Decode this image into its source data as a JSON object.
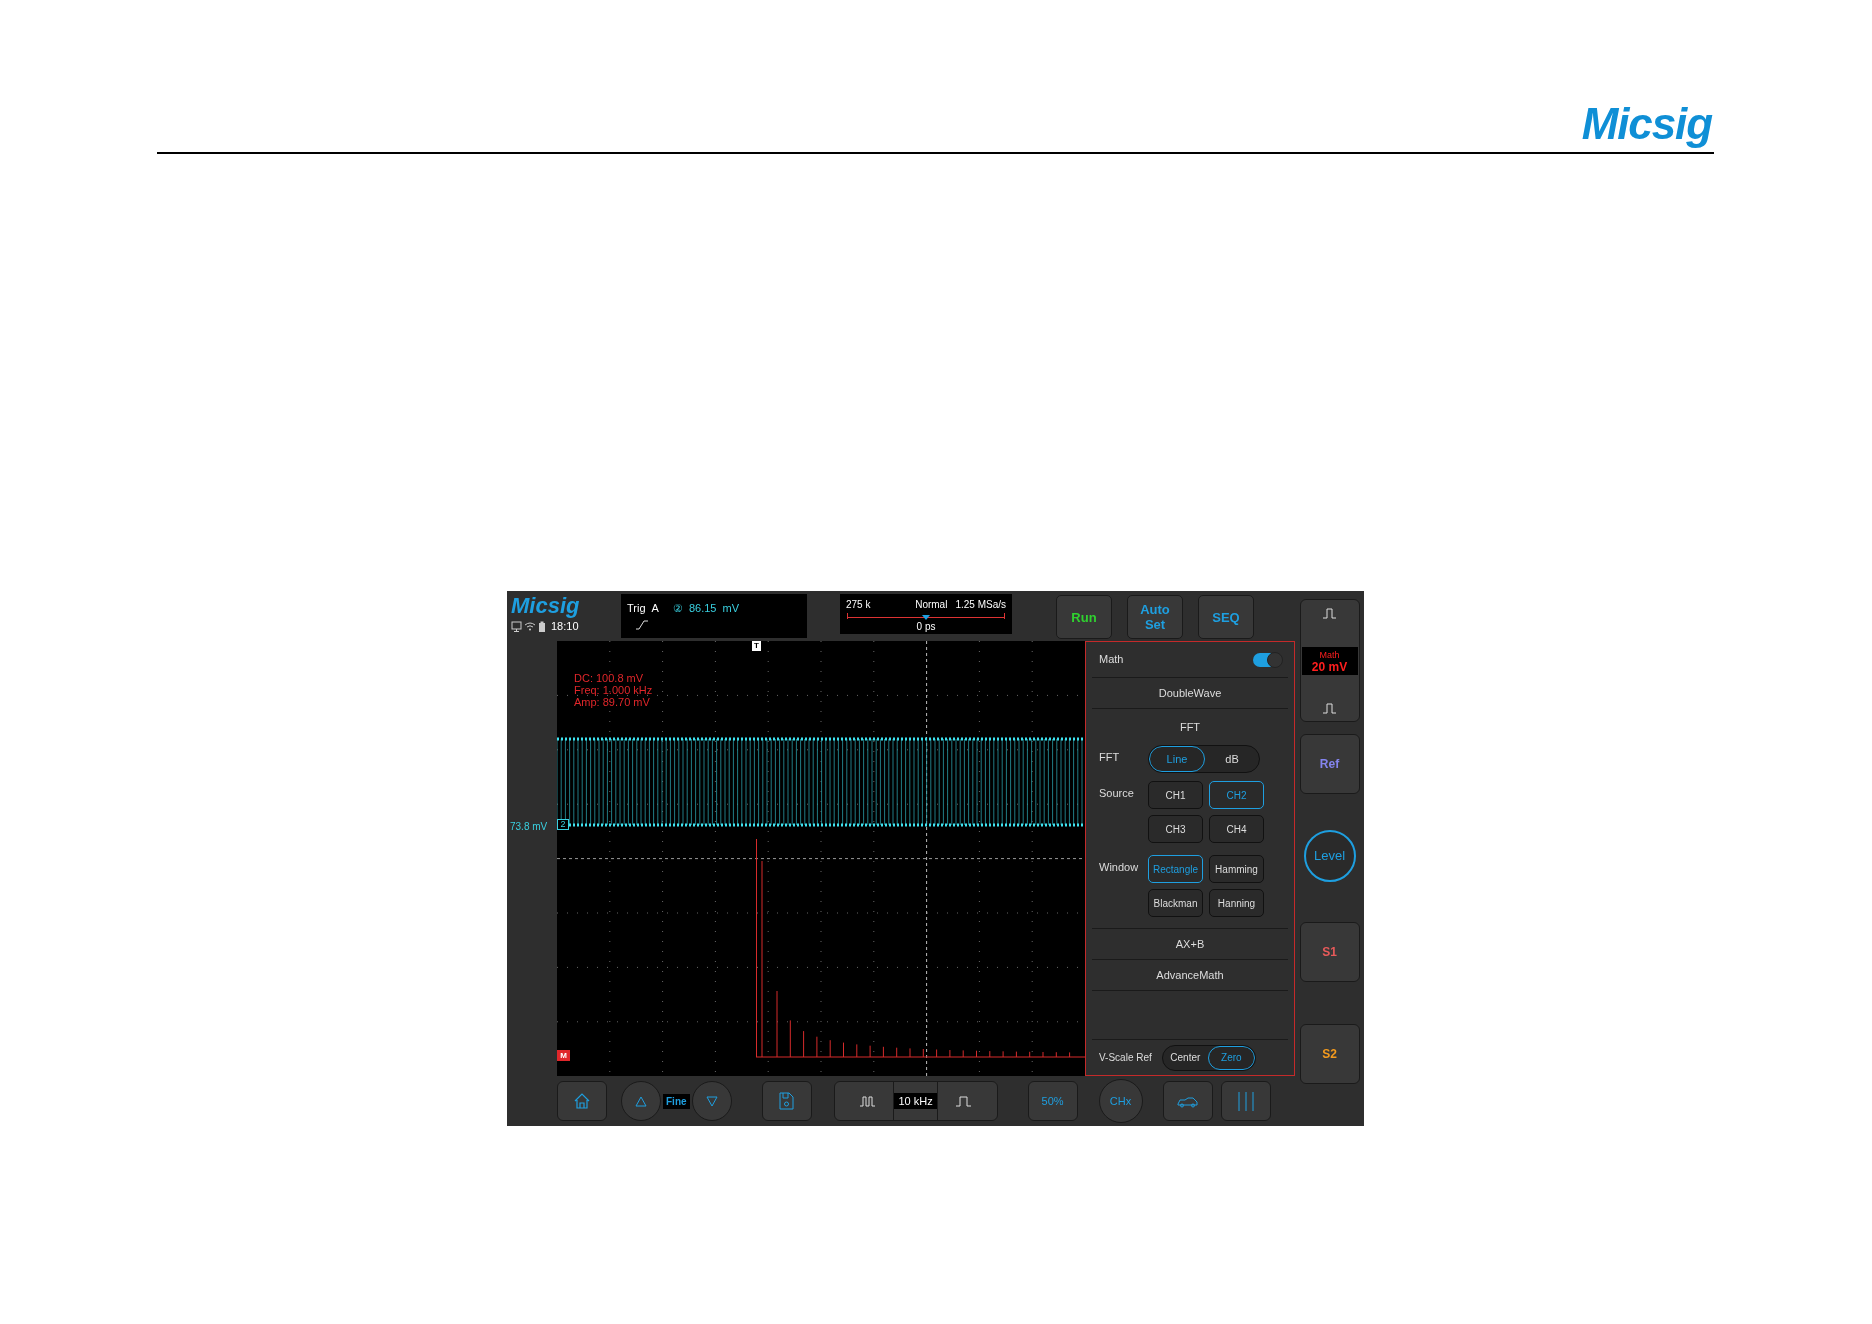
{
  "header": {
    "logo": "Micsig"
  },
  "scope": {
    "brand": "Micsig",
    "time": "18:10",
    "trigger": {
      "label": "Trig",
      "source": "A",
      "channel": "②",
      "value": "86.15  mV"
    },
    "timebase": {
      "memory": "275 k",
      "mode": "Normal",
      "sample_rate": "1.25 MSa/s",
      "offset": "0 ps",
      "level": 0.5
    },
    "top_buttons": [
      {
        "label": "Run",
        "color": "#2fd12f"
      },
      {
        "label": "Auto Set",
        "color": "#1e9fe0"
      },
      {
        "label": "SEQ",
        "color": "#1e9fe0"
      }
    ],
    "trigger_marker": "T",
    "channel_marker": "2",
    "channel_offset": "73.8 mV",
    "math_marker": "M",
    "measurements": [
      "DC: 100.8 mV",
      "Freq: 1.000 kHz",
      "Amp: 89.70 mV"
    ],
    "math_panel": {
      "title": "Math",
      "on": true,
      "items_before": [
        "DoubleWave"
      ],
      "fft_heading": "FFT",
      "fft_rows": [
        {
          "label": "FFT",
          "kind": "segmented",
          "options": [
            {
              "label": "Line",
              "selected": true
            },
            {
              "label": "dB",
              "selected": false
            }
          ]
        },
        {
          "label": "Source",
          "kind": "grid",
          "options": [
            {
              "label": "CH1",
              "selected": false
            },
            {
              "label": "CH2",
              "selected": true
            },
            {
              "label": "CH3",
              "selected": false
            },
            {
              "label": "CH4",
              "selected": false
            }
          ]
        },
        {
          "label": "Window",
          "kind": "grid",
          "options": [
            {
              "label": "Rectangle",
              "selected": true
            },
            {
              "label": "Hamming",
              "selected": false
            },
            {
              "label": "Blackman",
              "selected": false
            },
            {
              "label": "Hanning",
              "selected": false
            }
          ]
        }
      ],
      "items_after": [
        "AX+B",
        "AdvanceMath"
      ],
      "vscale": {
        "label": "V-Scale Ref",
        "options": [
          {
            "label": "Center",
            "selected": false
          },
          {
            "label": "Zero",
            "selected": true
          }
        ]
      }
    },
    "math_scale": {
      "label": "Math",
      "value": "20 mV"
    },
    "side_buttons": [
      {
        "label": "Ref",
        "kind": "square",
        "color": "#8484ee"
      },
      {
        "label": "Level",
        "kind": "circle",
        "color": "#1e9fe0"
      },
      {
        "label": "S1",
        "kind": "square",
        "color": "#e85a5a"
      },
      {
        "label": "S2",
        "kind": "square",
        "color": "#f39a1e"
      }
    ],
    "bottom": {
      "step": "Fine",
      "frequency": "10 kHz",
      "percent": "50%",
      "channel": "CHx"
    }
  }
}
